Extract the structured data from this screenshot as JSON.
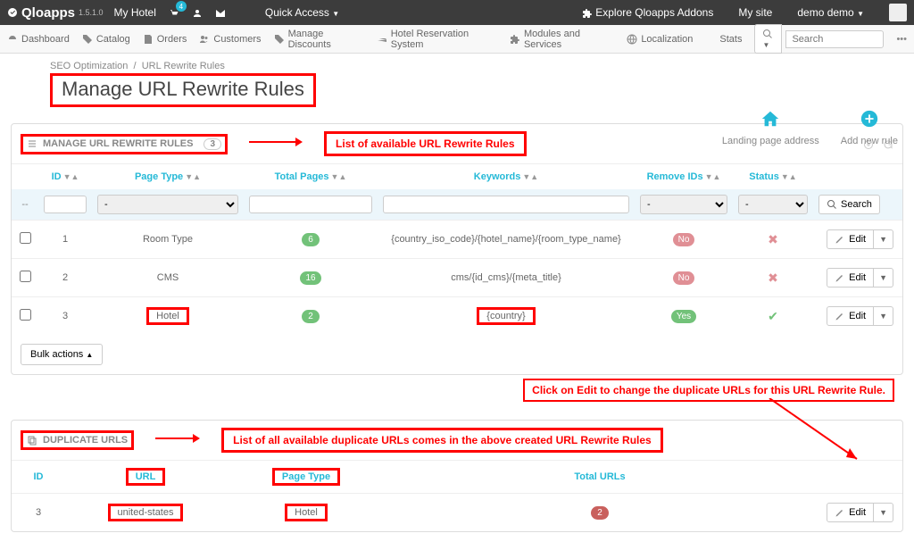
{
  "topbar": {
    "brand": "Qloapps",
    "version": "1.5.1.0",
    "my_hotel": "My Hotel",
    "cart_badge": "4",
    "quick_access": "Quick Access",
    "explore": "Explore Qloapps Addons",
    "my_site": "My site",
    "user": "demo demo"
  },
  "menu": {
    "dashboard": "Dashboard",
    "catalog": "Catalog",
    "orders": "Orders",
    "customers": "Customers",
    "discounts": "Manage Discounts",
    "reservation": "Hotel Reservation System",
    "modules": "Modules and Services",
    "localization": "Localization",
    "stats": "Stats",
    "search_ph": "Search"
  },
  "breadcrumb": {
    "a": "SEO Optimization",
    "b": "URL Rewrite Rules"
  },
  "page_title": "Manage URL Rewrite Rules",
  "head_actions": {
    "landing": "Landing page address",
    "add": "Add new rule"
  },
  "panel1": {
    "title": "MANAGE URL REWRITE RULES",
    "count": "3",
    "annotation": "List of available URL Rewrite Rules",
    "columns": {
      "id": "ID",
      "page_type": "Page Type",
      "total_pages": "Total Pages",
      "keywords": "Keywords",
      "remove_ids": "Remove IDs",
      "status": "Status"
    },
    "search_btn": "Search",
    "rows": [
      {
        "id": "1",
        "page_type": "Room Type",
        "total": "6",
        "total_color": "green",
        "keywords": "{country_iso_code}/{hotel_name}/{room_type_name}",
        "remove_ids": "No",
        "status": "cross"
      },
      {
        "id": "2",
        "page_type": "CMS",
        "total": "16",
        "total_color": "green",
        "keywords": "cms/{id_cms}/{meta_title}",
        "remove_ids": "No",
        "status": "cross"
      },
      {
        "id": "3",
        "page_type": "Hotel",
        "total": "2",
        "total_color": "green",
        "keywords": "{country}",
        "remove_ids": "Yes",
        "status": "check",
        "hl_page_type": true,
        "hl_keywords": true
      }
    ],
    "edit_label": "Edit",
    "bulk": "Bulk actions"
  },
  "annotation_edit": "Click on Edit to change the duplicate URLs for this URL Rewrite Rule.",
  "panel2": {
    "title": "DUPLICATE URLS",
    "annotation": "List of all available duplicate URLs comes in the above created URL Rewrite Rules",
    "columns": {
      "id": "ID",
      "url": "URL",
      "page_type": "Page Type",
      "total_urls": "Total URLs"
    },
    "row": {
      "id": "3",
      "url": "united-states",
      "page_type": "Hotel",
      "total": "2"
    },
    "edit_label": "Edit"
  }
}
